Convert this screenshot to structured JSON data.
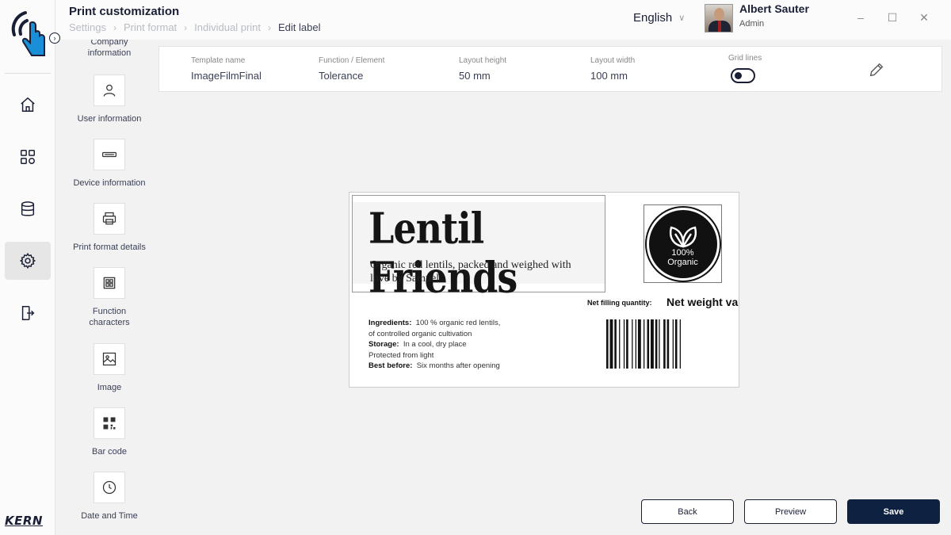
{
  "header": {
    "title": "Print customization",
    "breadcrumb": [
      "Settings",
      "Print format",
      "Individual print",
      "Edit label"
    ],
    "language": "English",
    "user": {
      "name": "Albert Sauter",
      "role": "Admin"
    },
    "window": {
      "minimize": "–",
      "maximize": "☐",
      "close": "✕"
    }
  },
  "rail": {
    "brand": "KERN",
    "nav": [
      "home-icon",
      "grid-icon",
      "database-icon",
      "gear-icon",
      "logout-icon"
    ],
    "active": "gear-icon"
  },
  "elements": [
    {
      "label": "Company information",
      "icon": "building-icon"
    },
    {
      "label": "User information",
      "icon": "user-icon"
    },
    {
      "label": "Device information",
      "icon": "scale-icon"
    },
    {
      "label": "Print format details",
      "icon": "printer-icon"
    },
    {
      "label": "Function characters",
      "icon": "function-grid-icon"
    },
    {
      "label": "Image",
      "icon": "image-icon"
    },
    {
      "label": "Bar code",
      "icon": "qr-code-icon"
    },
    {
      "label": "Date and Time",
      "icon": "clock-icon"
    }
  ],
  "info": {
    "template_name": {
      "label": "Template name",
      "value": "ImageFilmFinal"
    },
    "function_element": {
      "label": "Function / Element",
      "value": "Tolerance"
    },
    "layout_height": {
      "label": "Layout height",
      "value": "50 mm"
    },
    "layout_width": {
      "label": "Layout width",
      "value": "100 mm"
    },
    "grid_lines": {
      "label": "Grid lines",
      "enabled": false
    }
  },
  "label_preview": {
    "brand": "Lentil Friends",
    "tagline": "Organic red lentils, packed and weighed with love by Samuel",
    "badge_line1": "100%",
    "badge_line2": "Organic",
    "net_label": "Net filling quantity:",
    "net_value": "Net weight va",
    "ingredients_label": "Ingredients:",
    "ingredients_value": "100 % organic red lentils,",
    "ingredients_line2": "of controlled organic cultivation",
    "storage_label": "Storage:",
    "storage_value": "In a cool, dry place",
    "storage_line2": "Protected from light",
    "best_before_label": "Best before:",
    "best_before_value": "Six months after opening"
  },
  "buttons": {
    "back": "Back",
    "preview": "Preview",
    "save": "Save"
  },
  "colors": {
    "primary": "#0f2140",
    "text": "#1a1f36",
    "background": "#f2f2f2"
  }
}
